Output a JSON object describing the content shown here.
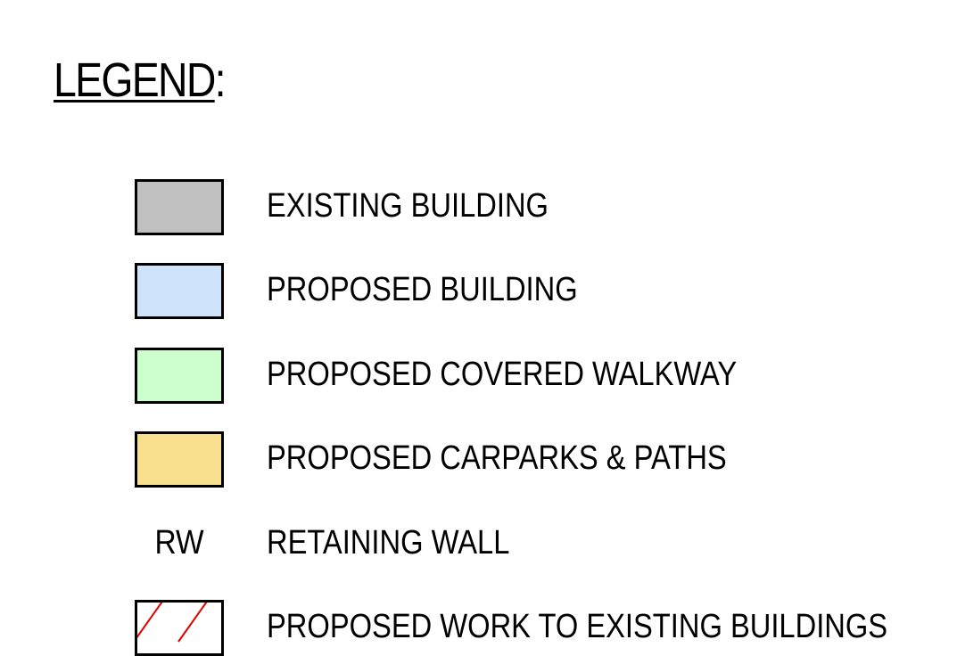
{
  "legend": {
    "title": "LEGEND",
    "colon": ":",
    "items": [
      {
        "label": "EXISTING BUILDING",
        "fill": "#c0c0c0",
        "icon": "gray-swatch-icon"
      },
      {
        "label": "PROPOSED BUILDING",
        "fill": "#cfe4fb",
        "icon": "blue-swatch-icon"
      },
      {
        "label": "PROPOSED COVERED WALKWAY",
        "fill": "#ccffcc",
        "icon": "green-swatch-icon"
      },
      {
        "label": "PROPOSED CARPARKS & PATHS",
        "fill": "#f8e08e",
        "icon": "yellow-swatch-icon"
      },
      {
        "label": "RETAINING WALL",
        "code": "RW"
      },
      {
        "label": "PROPOSED WORK TO EXISTING BUILDINGS",
        "fill": "#ffffff",
        "hatch_color": "#e00000",
        "icon": "red-hatch-swatch-icon"
      }
    ]
  }
}
